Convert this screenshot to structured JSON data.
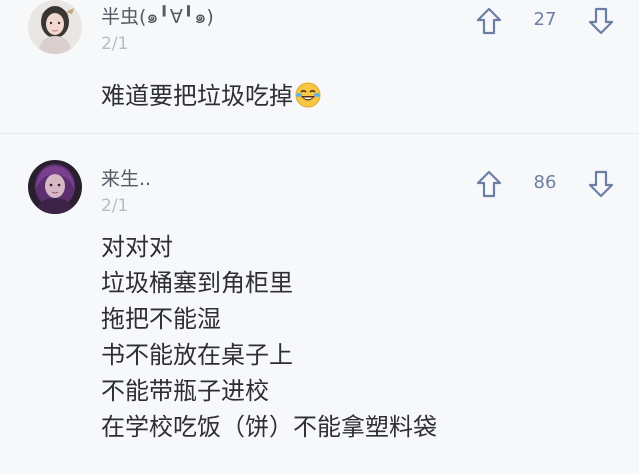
{
  "comments": [
    {
      "username": "半虫(๑╹∀╹๑)",
      "floor": "2/1",
      "votes": "27",
      "text": "难道要把垃圾吃掉",
      "emoji": "laughing-crying-emoji"
    },
    {
      "username": "来生..",
      "floor": "2/1",
      "votes": "86",
      "lines": [
        "对对对",
        "垃圾桶塞到角柜里",
        "拖把不能湿",
        "书不能放在桌子上",
        "不能带瓶子进校",
        "在学校吃饭（饼）不能拿塑料袋"
      ]
    }
  ],
  "icons": {
    "upvote": "arrow-up-icon",
    "downvote": "arrow-down-icon"
  },
  "colors": {
    "background": "#f7f8fa",
    "vote_icon": "#6c7fa3",
    "username": "#555a63",
    "floor": "#b7bbc2",
    "body_text": "#2e2f33"
  }
}
